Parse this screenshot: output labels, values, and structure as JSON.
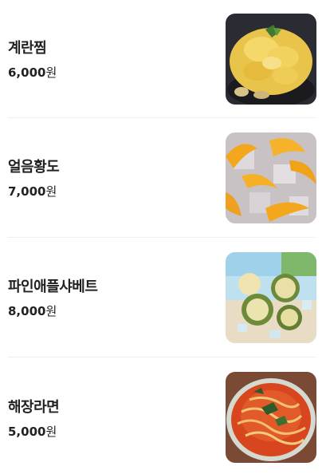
{
  "menu": {
    "items": [
      {
        "name": "계란찜",
        "price_number": "6,000",
        "price_unit": "원",
        "image_icon": "steamed-egg-image"
      },
      {
        "name": "얼음황도",
        "price_number": "7,000",
        "price_unit": "원",
        "image_icon": "iced-peach-image"
      },
      {
        "name": "파인애플샤베트",
        "price_number": "8,000",
        "price_unit": "원",
        "image_icon": "pineapple-sherbet-image"
      },
      {
        "name": "해장라면",
        "price_number": "5,000",
        "price_unit": "원",
        "image_icon": "hangover-ramen-image"
      }
    ]
  }
}
